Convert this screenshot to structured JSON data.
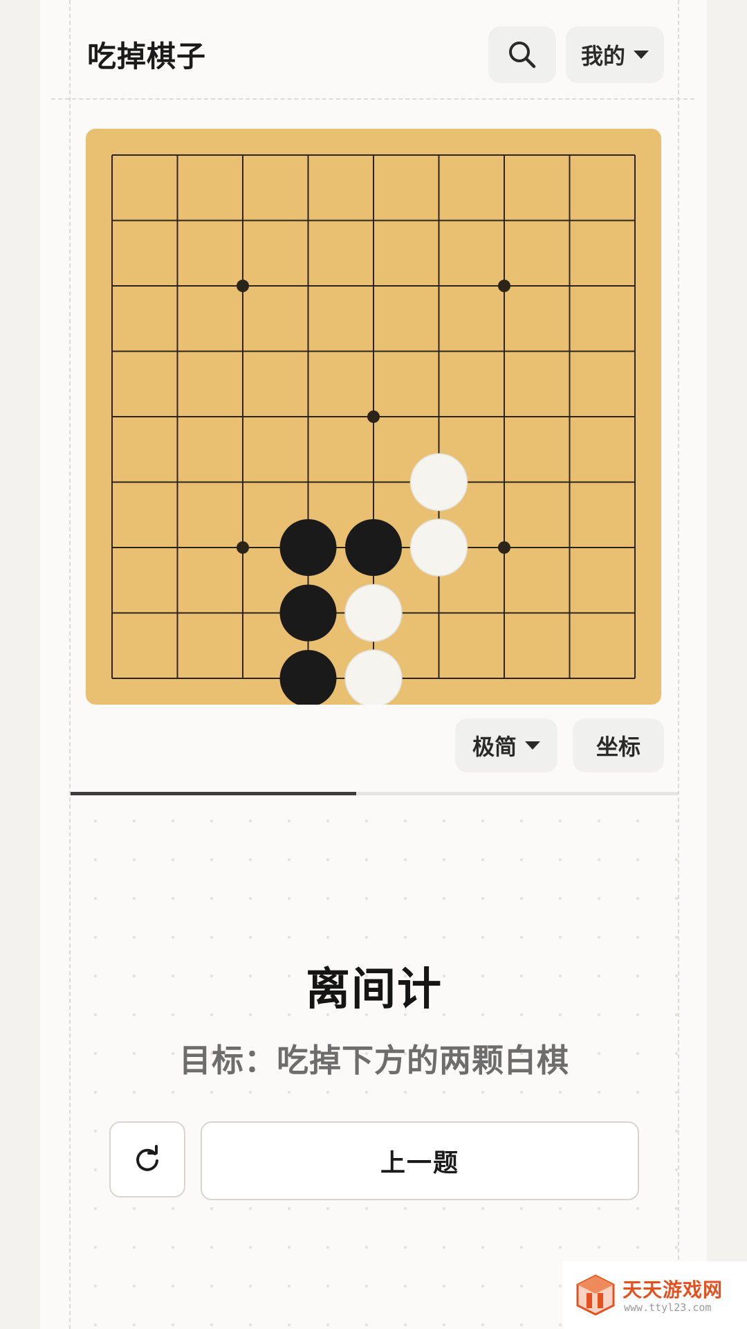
{
  "header": {
    "title": "吃掉棋子",
    "search_icon": "search-icon",
    "user_menu_label": "我的"
  },
  "board": {
    "size": 9,
    "star_points": [
      [
        2,
        2
      ],
      [
        2,
        6
      ],
      [
        4,
        4
      ],
      [
        6,
        2
      ],
      [
        6,
        6
      ]
    ],
    "stones": [
      {
        "color": "white",
        "row": 5,
        "col": 5
      },
      {
        "color": "black",
        "row": 6,
        "col": 3
      },
      {
        "color": "black",
        "row": 6,
        "col": 4
      },
      {
        "color": "white",
        "row": 6,
        "col": 5
      },
      {
        "color": "black",
        "row": 7,
        "col": 3
      },
      {
        "color": "white",
        "row": 7,
        "col": 4
      },
      {
        "color": "black",
        "row": 8,
        "col": 3
      },
      {
        "color": "white",
        "row": 8,
        "col": 4
      }
    ],
    "colors": {
      "wood": "#e9c072",
      "line": "#2b2418",
      "black_stone": "#1a1a1a",
      "white_stone": "#f5f4ef"
    }
  },
  "board_controls": {
    "style_label": "极简",
    "coords_label": "坐标"
  },
  "progress": {
    "fraction": 0.47
  },
  "puzzle": {
    "title": "离间计",
    "goal": "目标：吃掉下方的两颗白棋"
  },
  "actions": {
    "reset_icon": "refresh-icon",
    "prev_label": "上一题"
  },
  "watermark": {
    "brand": "天天游戏网",
    "url": "www.ttyl23.com"
  }
}
